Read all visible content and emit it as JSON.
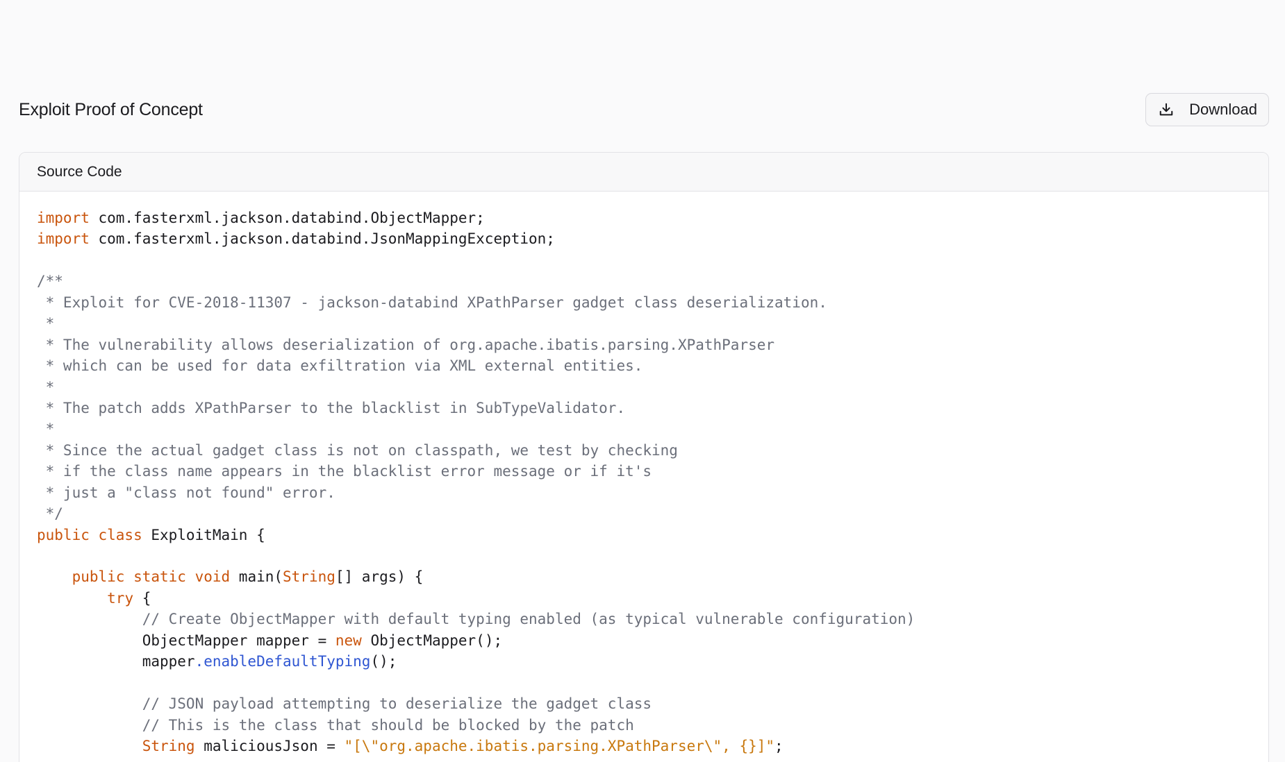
{
  "page": {
    "title": "Exploit Proof of Concept",
    "download_label": "Download"
  },
  "panel": {
    "title": "Source Code"
  },
  "colors": {
    "keyword": "#c9540c",
    "comment": "#6b6f7a",
    "string": "#c8780e",
    "method": "#2f56d2",
    "text": "#1b1b1f"
  },
  "icons": {
    "download": "download-icon"
  },
  "code_lines": [
    [
      {
        "t": "kw",
        "v": "import"
      },
      {
        "t": "tx",
        "v": " com.fasterxml.jackson.databind.ObjectMapper;"
      }
    ],
    [
      {
        "t": "kw",
        "v": "import"
      },
      {
        "t": "tx",
        "v": " com.fasterxml.jackson.databind.JsonMappingException;"
      }
    ],
    [],
    [
      {
        "t": "cm",
        "v": "/**"
      }
    ],
    [
      {
        "t": "cm",
        "v": " * Exploit for CVE-2018-11307 - jackson-databind XPathParser gadget class deserialization."
      }
    ],
    [
      {
        "t": "cm",
        "v": " *"
      }
    ],
    [
      {
        "t": "cm",
        "v": " * The vulnerability allows deserialization of org.apache.ibatis.parsing.XPathParser"
      }
    ],
    [
      {
        "t": "cm",
        "v": " * which can be used for data exfiltration via XML external entities."
      }
    ],
    [
      {
        "t": "cm",
        "v": " *"
      }
    ],
    [
      {
        "t": "cm",
        "v": " * The patch adds XPathParser to the blacklist in SubTypeValidator."
      }
    ],
    [
      {
        "t": "cm",
        "v": " *"
      }
    ],
    [
      {
        "t": "cm",
        "v": " * Since the actual gadget class is not on classpath, we test by checking"
      }
    ],
    [
      {
        "t": "cm",
        "v": " * if the class name appears in the blacklist error message or if it's"
      }
    ],
    [
      {
        "t": "cm",
        "v": " * just a \"class not found\" error."
      }
    ],
    [
      {
        "t": "cm",
        "v": " */"
      }
    ],
    [
      {
        "t": "kw",
        "v": "public class"
      },
      {
        "t": "tx",
        "v": " ExploitMain {"
      }
    ],
    [],
    [
      {
        "t": "tx",
        "v": "    "
      },
      {
        "t": "kw",
        "v": "public static void"
      },
      {
        "t": "tx",
        "v": " main("
      },
      {
        "t": "kw",
        "v": "String"
      },
      {
        "t": "tx",
        "v": "[] args) {"
      }
    ],
    [
      {
        "t": "tx",
        "v": "        "
      },
      {
        "t": "kw",
        "v": "try"
      },
      {
        "t": "tx",
        "v": " {"
      }
    ],
    [
      {
        "t": "tx",
        "v": "            "
      },
      {
        "t": "cm",
        "v": "// Create ObjectMapper with default typing enabled (as typical vulnerable configuration)"
      }
    ],
    [
      {
        "t": "tx",
        "v": "            ObjectMapper mapper = "
      },
      {
        "t": "kw",
        "v": "new"
      },
      {
        "t": "tx",
        "v": " ObjectMapper();"
      }
    ],
    [
      {
        "t": "tx",
        "v": "            mapper"
      },
      {
        "t": "fn",
        "v": ".enableDefaultTyping"
      },
      {
        "t": "tx",
        "v": "();"
      }
    ],
    [],
    [
      {
        "t": "tx",
        "v": "            "
      },
      {
        "t": "cm",
        "v": "// JSON payload attempting to deserialize the gadget class"
      }
    ],
    [
      {
        "t": "tx",
        "v": "            "
      },
      {
        "t": "cm",
        "v": "// This is the class that should be blocked by the patch"
      }
    ],
    [
      {
        "t": "tx",
        "v": "            "
      },
      {
        "t": "kw",
        "v": "String"
      },
      {
        "t": "tx",
        "v": " maliciousJson = "
      },
      {
        "t": "str",
        "v": "\"[\\\"org.apache.ibatis.parsing.XPathParser\\\", {}]\""
      },
      {
        "t": "tx",
        "v": ";"
      }
    ]
  ]
}
